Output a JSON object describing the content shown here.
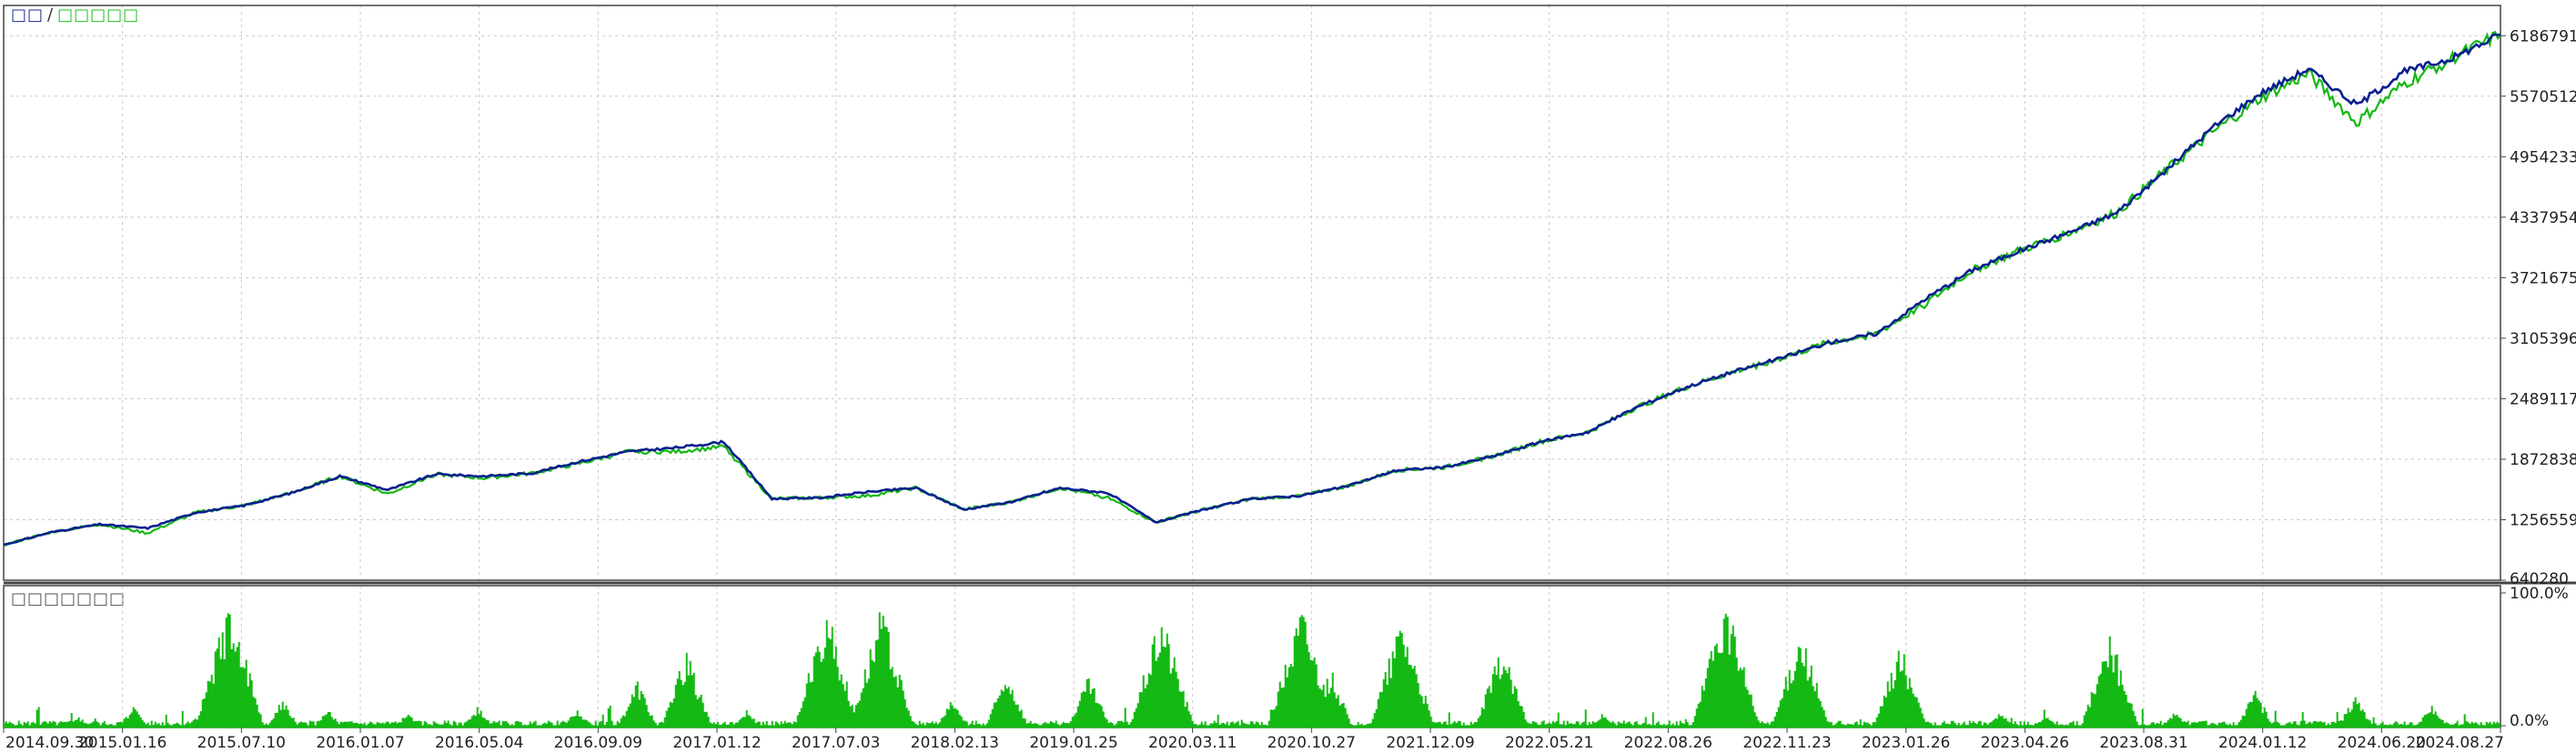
{
  "legend": {
    "series_a": "□□",
    "separator": "/",
    "series_b": "□□□□□",
    "lower_panel": "□□□□□□□"
  },
  "colors": {
    "balance": "#0a1f8f",
    "equity": "#12b812",
    "load": "#12b812",
    "grid": "#c8c8c8",
    "axis": "#444444"
  },
  "chart_data": [
    {
      "type": "line",
      "series": [
        {
          "color": "#0a1f8f",
          "values": [
            1000000,
            1130000,
            1210000,
            1170000,
            1330000,
            1400000,
            1530000,
            1700000,
            1560000,
            1720000,
            1700000,
            1730000,
            1850000,
            1950000,
            1990000,
            2050000,
            1470000,
            1480000,
            1540000,
            1580000,
            1360000,
            1440000,
            1580000,
            1530000,
            1230000,
            1360000,
            1470000,
            1500000,
            1600000,
            1760000,
            1790000,
            1900000,
            2050000,
            2150000,
            2400000,
            2600000,
            2760000,
            2900000,
            3060000,
            3150000,
            3500000,
            3800000,
            4000000,
            4180000,
            4380000,
            4800000,
            5250000,
            5600000,
            5850000,
            5480000,
            5820000,
            5960000,
            6200000
          ]
        },
        {
          "color": "#12b812",
          "values": [
            1000000,
            1130000,
            1210000,
            1120000,
            1330000,
            1400000,
            1530000,
            1700000,
            1520000,
            1720000,
            1680000,
            1730000,
            1830000,
            1950000,
            1950000,
            2000000,
            1470000,
            1480000,
            1500000,
            1580000,
            1360000,
            1440000,
            1580000,
            1480000,
            1230000,
            1360000,
            1470000,
            1500000,
            1600000,
            1760000,
            1790000,
            1900000,
            2050000,
            2150000,
            2400000,
            2600000,
            2760000,
            2900000,
            3060000,
            3150000,
            3450000,
            3800000,
            4000000,
            4180000,
            4380000,
            4800000,
            5200000,
            5550000,
            5800000,
            5300000,
            5700000,
            5960000,
            6200000
          ]
        }
      ],
      "y_ticks": [
        "6186791",
        "5570512",
        "4954233",
        "4337954",
        "3721675",
        "3105396",
        "2489117",
        "1872838",
        "1256559",
        "640280"
      ],
      "ylim": [
        640280,
        6494930
      ],
      "grid": true
    },
    {
      "type": "bar",
      "y_ticks": [
        "100.0%",
        "0.0%"
      ],
      "ylim": [
        0,
        100
      ],
      "spikes": [
        {
          "t": 0.03,
          "v": 8
        },
        {
          "t": 0.052,
          "v": 16
        },
        {
          "t": 0.078,
          "v": 10
        },
        {
          "t": 0.091,
          "v": 100
        },
        {
          "t": 0.112,
          "v": 22
        },
        {
          "t": 0.13,
          "v": 14
        },
        {
          "t": 0.162,
          "v": 12
        },
        {
          "t": 0.19,
          "v": 16
        },
        {
          "t": 0.23,
          "v": 15
        },
        {
          "t": 0.254,
          "v": 38
        },
        {
          "t": 0.274,
          "v": 60
        },
        {
          "t": 0.298,
          "v": 14
        },
        {
          "t": 0.33,
          "v": 92
        },
        {
          "t": 0.352,
          "v": 94
        },
        {
          "t": 0.38,
          "v": 22
        },
        {
          "t": 0.402,
          "v": 45
        },
        {
          "t": 0.435,
          "v": 40
        },
        {
          "t": 0.464,
          "v": 90
        },
        {
          "t": 0.52,
          "v": 96
        },
        {
          "t": 0.532,
          "v": 45
        },
        {
          "t": 0.56,
          "v": 88
        },
        {
          "t": 0.6,
          "v": 64
        },
        {
          "t": 0.64,
          "v": 10
        },
        {
          "t": 0.69,
          "v": 100
        },
        {
          "t": 0.72,
          "v": 78
        },
        {
          "t": 0.76,
          "v": 65
        },
        {
          "t": 0.8,
          "v": 12
        },
        {
          "t": 0.818,
          "v": 10
        },
        {
          "t": 0.844,
          "v": 74
        },
        {
          "t": 0.87,
          "v": 12
        },
        {
          "t": 0.902,
          "v": 30
        },
        {
          "t": 0.942,
          "v": 26
        },
        {
          "t": 0.973,
          "v": 18
        }
      ]
    }
  ],
  "x_axis": {
    "labels": [
      "2014.09.30",
      "2015.01.16",
      "2015.07.10",
      "2016.01.07",
      "2016.05.04",
      "2016.09.09",
      "2017.01.12",
      "2017.07.03",
      "2018.02.13",
      "2019.01.25",
      "2020.03.11",
      "2020.10.27",
      "2021.12.09",
      "2022.05.21",
      "2022.08.26",
      "2022.11.23",
      "2023.01.26",
      "2023.04.26",
      "2023.08.31",
      "2024.01.12",
      "2024.06.20",
      "2024.08.27"
    ]
  }
}
